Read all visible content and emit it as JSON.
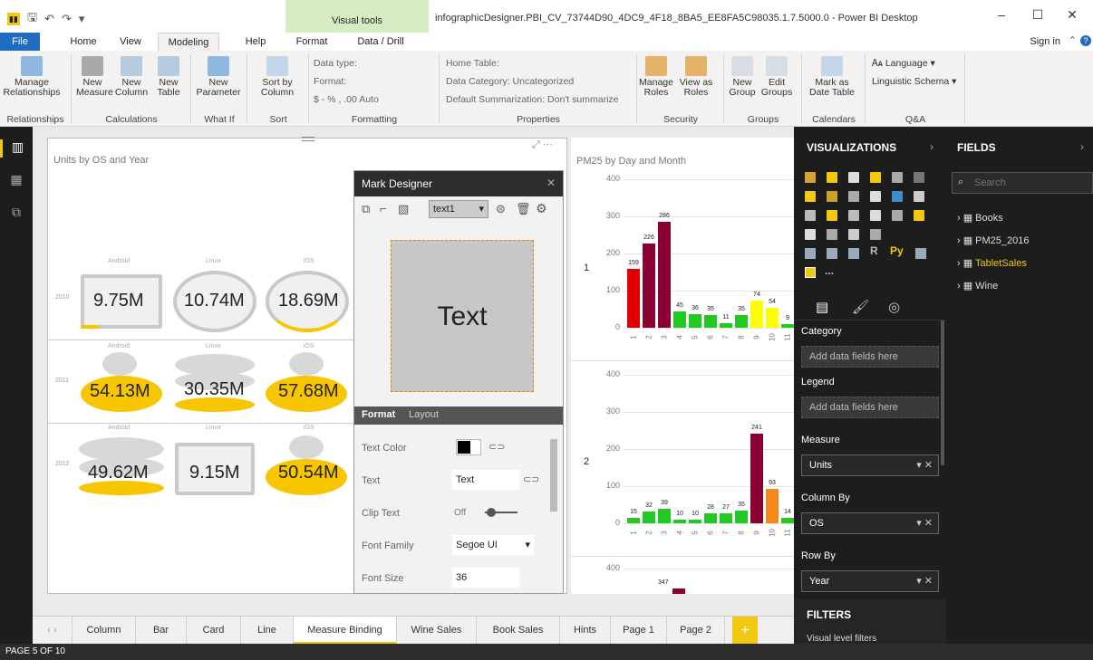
{
  "window": {
    "context_tab": "Visual tools",
    "title": "infographicDesigner.PBI_CV_73744D90_4DC9_4F18_8BA5_EE8FA5C98035.1.7.5000.0 - Power BI Desktop",
    "controls": [
      "–",
      "☐",
      "✕"
    ]
  },
  "tabs": [
    "File",
    "Home",
    "View",
    "Modeling",
    "Help",
    "Format",
    "Data / Drill"
  ],
  "active_tab": "Modeling",
  "signin": "Sign in",
  "ribbon": {
    "manage_relationships": "Manage Relationships",
    "new_measure": "New Measure",
    "new_column": "New Column",
    "new_table": "New Table",
    "new_parameter": "New Parameter",
    "sort_by_column": "Sort by Column",
    "data_type": "Data type:",
    "format": "Format:",
    "format_symbols": "$ - % , .00 Auto",
    "home_table": "Home Table:",
    "data_category": "Data Category: Uncategorized",
    "default_summarization": "Default Summarization: Don't summarize",
    "manage_roles": "Manage Roles",
    "view_as_roles": "View as Roles",
    "new_group": "New Group",
    "edit_groups": "Edit Groups",
    "mark_as_date_table": "Mark as Date Table",
    "language": "Language",
    "linguistic_schema": "Linguistic Schema",
    "groups": [
      "Relationships",
      "Calculations",
      "What If",
      "Sort",
      "Formatting",
      "Properties",
      "Security",
      "Groups",
      "Calendars",
      "Q&A"
    ]
  },
  "visual1": {
    "title": "Units by OS and Year",
    "columns": [
      "Android",
      "Linux",
      "iOS"
    ],
    "rows": [
      {
        "year": "2010",
        "values": [
          "9.75M",
          "10.74M",
          "18.69M"
        ]
      },
      {
        "year": "2011",
        "values": [
          "54.13M",
          "30.35M",
          "57.68M"
        ]
      },
      {
        "year": "2012",
        "values": [
          "49.62M",
          "9.15M",
          "50.54M"
        ]
      }
    ]
  },
  "mark_designer": {
    "title": "Mark Designer",
    "selected_mark": "text1",
    "preview_text": "Text",
    "tabs": [
      "Format",
      "Layout"
    ],
    "props": [
      {
        "label": "Text Color",
        "value": ""
      },
      {
        "label": "Text",
        "value": "Text"
      },
      {
        "label": "Clip Text",
        "value": "Off"
      },
      {
        "label": "Font Family",
        "value": "Segoe UI"
      },
      {
        "label": "Font Size",
        "value": "36"
      }
    ]
  },
  "visual2": {
    "title": "PM25 by Day and Month",
    "panel_labels": [
      "1",
      "2"
    ],
    "yticks": [
      "400",
      "300",
      "200",
      "100",
      "0"
    ]
  },
  "chart_data": {
    "type": "bar",
    "title": "PM25 by Day and Month",
    "ylim": [
      0,
      400
    ],
    "series": [
      {
        "name": "1",
        "categories": [
          "1",
          "2",
          "3",
          "4",
          "5",
          "6",
          "7",
          "8",
          "9",
          "10",
          "11"
        ],
        "values": [
          159,
          226,
          286,
          45,
          36,
          35,
          11,
          35,
          74,
          54,
          9
        ]
      },
      {
        "name": "2",
        "categories": [
          "1",
          "2",
          "3",
          "4",
          "5",
          "6",
          "7",
          "8",
          "9",
          "10",
          "11"
        ],
        "values": [
          15,
          32,
          39,
          10,
          10,
          28,
          27,
          35,
          241,
          93,
          14
        ]
      }
    ]
  },
  "chart_extra_labels": [
    "347"
  ],
  "visualizations": {
    "title": "VISUALIZATIONS",
    "py": "Py",
    "r": "R",
    "more": "..."
  },
  "wells": [
    {
      "label": "Category",
      "value": "Add data fields here",
      "filled": false
    },
    {
      "label": "Legend",
      "value": "Add data fields here",
      "filled": false
    },
    {
      "label": "Measure",
      "value": "Units",
      "filled": true
    },
    {
      "label": "Column By",
      "value": "OS",
      "filled": true
    },
    {
      "label": "Row By",
      "value": "Year",
      "filled": true
    }
  ],
  "filters": {
    "title": "FILTERS",
    "sub": "Visual level filters"
  },
  "fields": {
    "title": "FIELDS",
    "search_placeholder": "Search",
    "items": [
      "Books",
      "PM25_2016",
      "TabletSales",
      "Wine"
    ],
    "highlight": "TabletSales"
  },
  "page_tabs": [
    "Column",
    "Bar",
    "Card",
    "Line",
    "Measure Binding",
    "Wine Sales",
    "Book Sales",
    "Hints",
    "Page 1",
    "Page 2"
  ],
  "active_page": "Measure Binding",
  "status": "PAGE 5 OF 10",
  "colors": {
    "red": "#e00000",
    "maroon": "#8b0033",
    "green": "#22c922",
    "yellow": "#ffff00",
    "orange": "#f4891a",
    "accent": "#f2c811"
  }
}
